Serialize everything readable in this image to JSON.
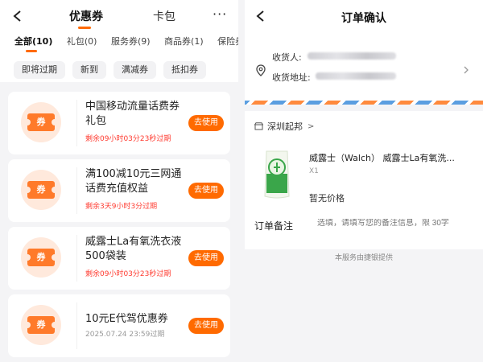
{
  "left": {
    "tabs": [
      {
        "label": "优惠券"
      },
      {
        "label": "卡包"
      }
    ],
    "more_label": "···",
    "categories": [
      "全部(10)",
      "礼包(0)",
      "服务券(9)",
      "商品券(1)",
      "保险券("
    ],
    "filters": [
      "即将过期",
      "新到",
      "满减券",
      "抵扣券"
    ],
    "coupons": [
      {
        "icon_text": "券",
        "title": "中国移动流量话费券礼包",
        "sub": "剩余09小时03分23秒过期",
        "button": "去使用"
      },
      {
        "icon_text": "券",
        "title": "满100减10元三网通话费充值权益",
        "sub": "剩余3天9小时3分过期",
        "button": "去使用"
      },
      {
        "icon_text": "券",
        "title": "威露士La有氧洗衣液500袋装",
        "sub": "剩余09小时03分23秒过期",
        "button": "去使用"
      },
      {
        "icon_text": "券",
        "title": "10元E代驾优惠券",
        "sub": "2025.07.24 23:59过期",
        "button": "去使用"
      }
    ],
    "colors": {
      "accent": "#ff6a00",
      "expire_red": "#ff3b30"
    }
  },
  "right": {
    "title": "订单确认",
    "receiver_label": "收货人:",
    "address_label": "收货地址:",
    "store_name": "深圳起邦",
    "store_chevron": ">",
    "product_name": "威露士（Walch） 威露士La有氧洗...",
    "product_qty": "X1",
    "product_price": "暂无价格",
    "note_label": "订单备注",
    "note_placeholder": "选填，请填写您的备注信息，限 30字",
    "footer": "本服务由捷银提供"
  }
}
